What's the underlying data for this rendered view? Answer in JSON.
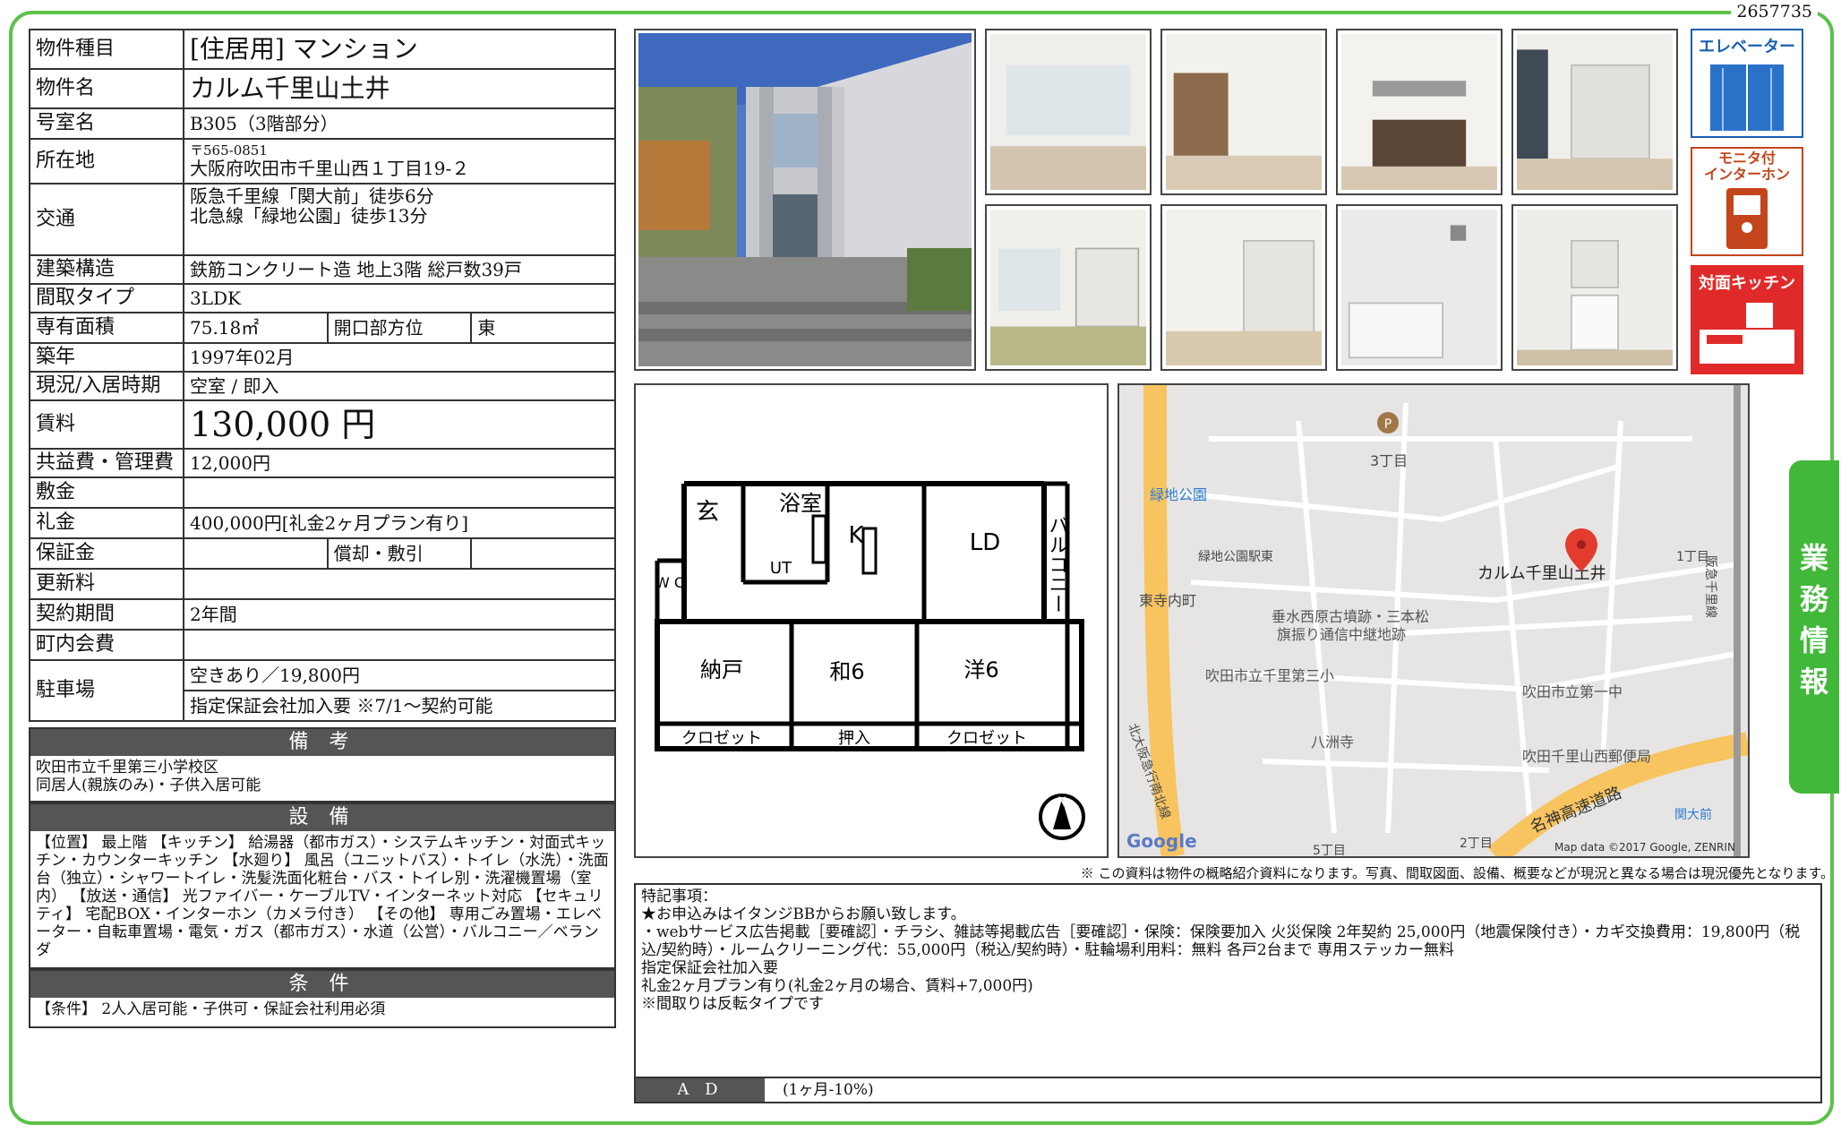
{
  "doc_id": "2657735",
  "property": {
    "type_label": "物件種目",
    "type_value": "[住居用]  マンション",
    "name_label": "物件名",
    "name_value": "カルム千里山土井",
    "room_label": "号室名",
    "room_value": "B305（3階部分）",
    "address_label": "所在地",
    "zip": "〒565-0851",
    "address": "大阪府吹田市千里山西１丁目19-２",
    "access_label": "交通",
    "access_1": "阪急千里線「関大前」徒歩6分",
    "access_2": "北急線「緑地公園」徒歩13分",
    "structure_label": "建築構造",
    "structure_value": "鉄筋コンクリート造  地上3階  総戸数39戸",
    "layout_label": "間取タイプ",
    "layout_value": "3LDK",
    "area_label": "専有面積",
    "area_value": "75.18㎡",
    "direction_label": "開口部方位",
    "direction_value": "東",
    "built_label": "築年",
    "built_value": "1997年02月",
    "status_label": "現況/入居時期",
    "status_value": "空室  /  即入",
    "rent_label": "賃料",
    "rent_value": "130,000  円",
    "common_label": "共益費・管理費",
    "common_value": "12,000円",
    "deposit_label": "敷金",
    "deposit_value": "",
    "key_money_label": "礼金",
    "key_money_value": "400,000円[礼金2ヶ月プラン有り]",
    "guarantee_label": "保証金",
    "guarantee_value": "",
    "amort_label": "償却・敷引",
    "amort_value": "",
    "renewal_label": "更新料",
    "renewal_value": "",
    "contract_label": "契約期間",
    "contract_value": "2年間",
    "town_label": "町内会費",
    "town_value": "",
    "parking_label": "駐車場",
    "parking_value_1": "空きあり／19,800円",
    "parking_value_2": "指定保証会社加入要    ※7/1〜契約可能"
  },
  "remarks": {
    "title": "備 考",
    "line_1": "吹田市立千里第三小学校区",
    "line_2": "同居人(親族のみ)・子供入居可能"
  },
  "facilities": {
    "title": "設 備",
    "text": "【位置】 最上階 【キッチン】 給湯器（都市ガス）・システムキッチン・対面式キッチン・カウンターキッチン 【水廻り】 風呂（ユニットバス）・トイレ（水洗）・洗面台（独立）・シャワートイレ・洗髪洗面化粧台・バス・トイレ別・洗濯機置場（室内） 【放送・通信】 光ファイバー・ケーブルTV・インターネット対応 【セキュリティ】 宅配BOX・インターホン（カメラ付き） 【その他】 専用ごみ置場・エレベーター・自転車置場・電気・ガス（都市ガス）・水道（公営）・バルコニー／ベランダ"
  },
  "conditions": {
    "title": "条 件",
    "text": "【条件】 2人入居可能・子供可・保証会社利用必須"
  },
  "icons": {
    "elevator": "エレベーター",
    "intercom_1": "モニタ付",
    "intercom_2": "インターホン",
    "kitchen": "対面キッチン"
  },
  "floor_plan": {
    "genkan": "玄",
    "bath": "浴室",
    "ut": "UT",
    "wc": "W C",
    "k": "K",
    "ld": "LD",
    "balcony": "バルコニー",
    "nando": "納戸",
    "wa6": "和6",
    "yo6": "洋6",
    "closet_1": "クロゼット",
    "oshiire": "押入",
    "closet_2": "クロゼット",
    "north": "N"
  },
  "map": {
    "parking_p": "P",
    "chome3": "3丁目",
    "ryokuchi": "緑地公園",
    "ryokuchi_east": "緑地公園駅東",
    "higashi": "東寺内町",
    "chome1": "1丁目",
    "target": "カルム千里山土井",
    "tarumi_1": "垂水西原古墳跡・三本松",
    "tarumi_2": "旗振り通信中継地跡",
    "school3": "吹田市立千里第三小",
    "school1": "吹田市立第一中",
    "hassu": "八洲寺",
    "post": "吹田千里山西郵便局",
    "kandai": "関大前",
    "expressway": "名神高速道路",
    "kita": "北大阪急行南北線",
    "rail": "阪急千里線",
    "chome2": "2丁目",
    "chome5": "5丁目",
    "google": "Google",
    "credit": "Map data ©2017 Google, ZENRIN"
  },
  "disclaimer": "※ この資料は物件の概略紹介資料になります。写真、間取図面、設備、概要などが現況と異なる場合は現況優先となります。",
  "special": {
    "title": "特記事項：",
    "l1": "★お申込みはイタンジBBからお願い致します。",
    "l2": "・webサービス広告掲載［要確認］・チラシ、雑誌等掲載広告［要確認］・保険：保険要加入 火災保険 2年契約 25,000円（地震保険付き）・カギ交換費用：19,800円（税込/契約時）・ルームクリーニング代：55,000円（税込/契約時）・駐輪場利用料：無料  各戸2台まで  専用ステッカー無料",
    "l3": "指定保証会社加入要",
    "l4": "礼金2ヶ月プラン有り(礼金2ヶ月の場合、賃料+7,000円)",
    "l5": "※間取りは反転タイプです",
    "ad_label": "A D",
    "ad_value": "(1ヶ月-10%)"
  },
  "side_tab": [
    "業",
    "務",
    "情",
    "報"
  ]
}
